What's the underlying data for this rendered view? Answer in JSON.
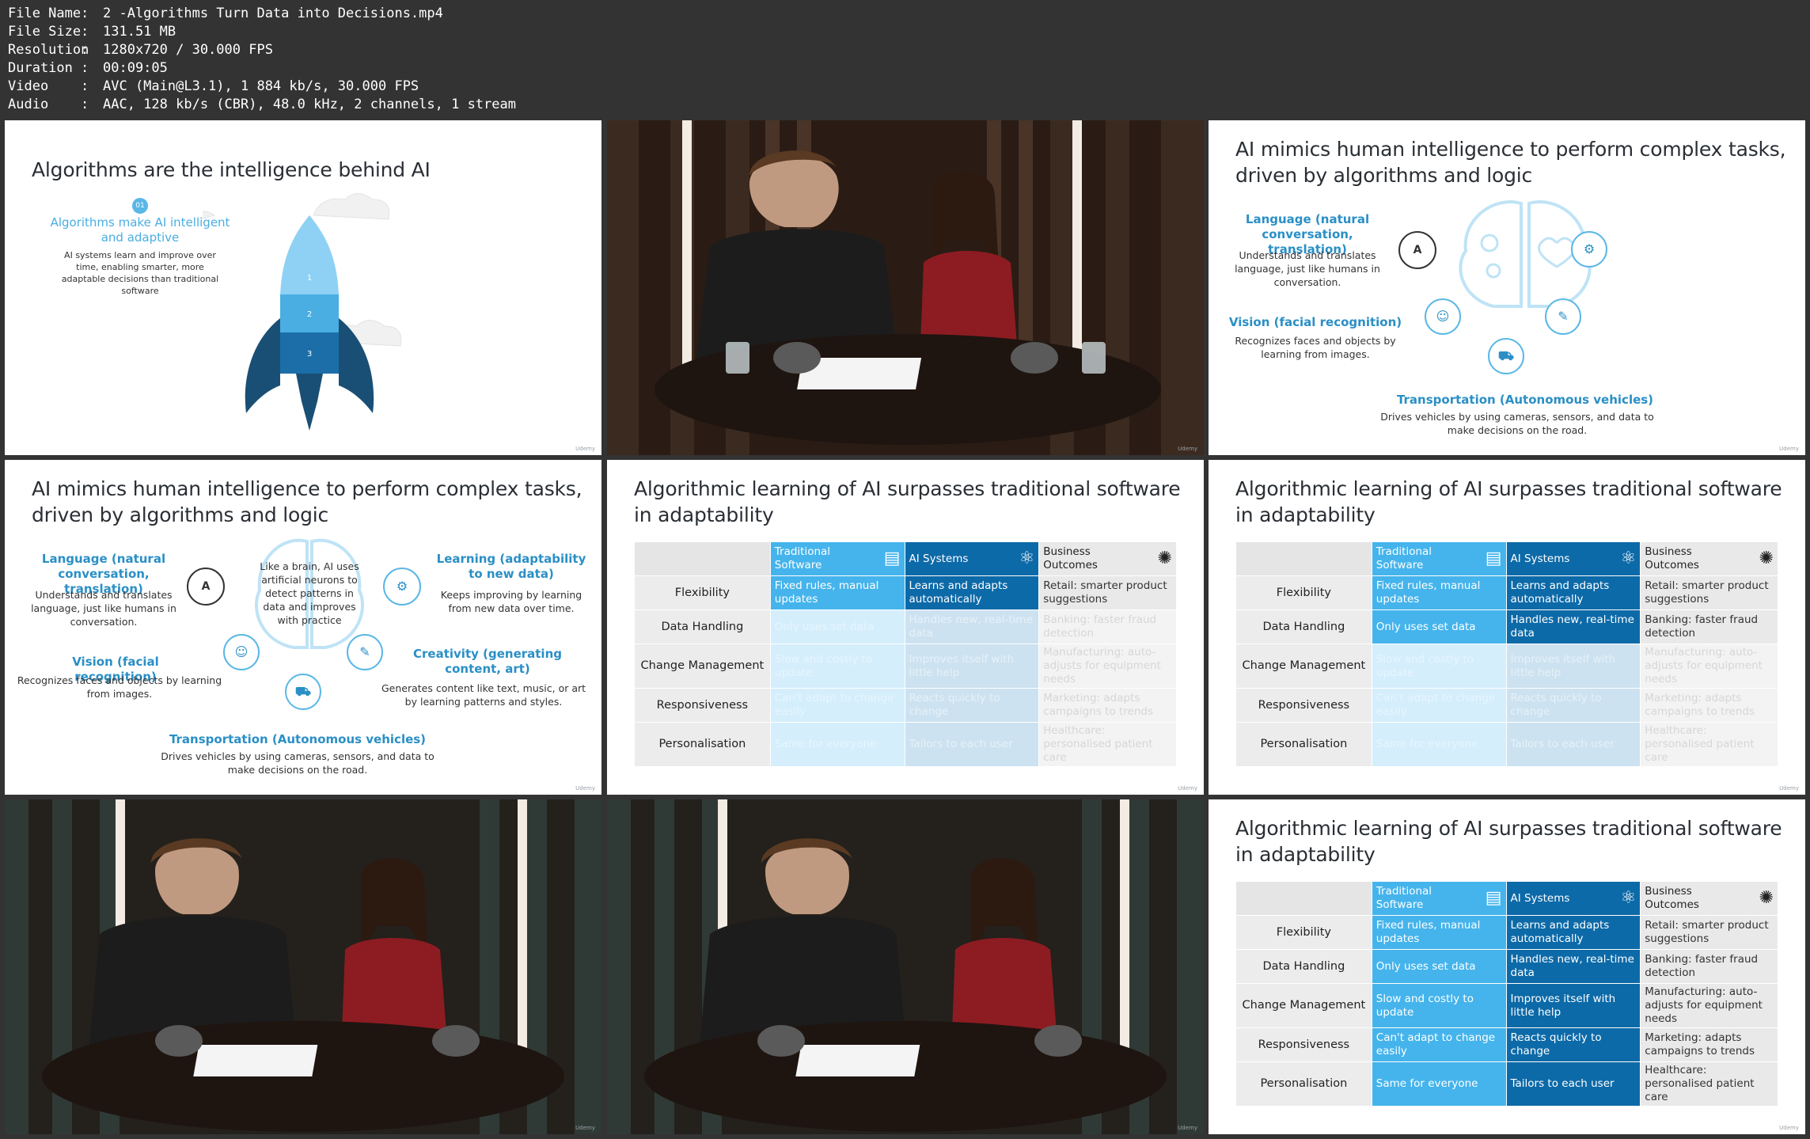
{
  "file_info": [
    {
      "key": "File Name",
      "value": "2 -Algorithms Turn Data into Decisions.mp4"
    },
    {
      "key": "File Size",
      "value": "131.51 MB"
    },
    {
      "key": "Resolution",
      "value": "1280x720 / 30.000 FPS"
    },
    {
      "key": "Duration",
      "value": "00:09:05"
    },
    {
      "key": "Video",
      "value": "AVC (Main@L3.1), 1 884 kb/s, 30.000 FPS"
    },
    {
      "key": "Audio",
      "value": "AAC, 128 kb/s (CBR), 48.0 kHz, 2 channels, 1 stream"
    }
  ],
  "separator": ":",
  "watermark": "Udemy",
  "slide_rocket": {
    "title": "Algorithms are the intelligence behind AI",
    "badge": "01",
    "heading": "Algorithms make AI intelligent and adaptive",
    "body": "AI systems learn and improve over time, enabling smarter, more adaptable decisions than traditional software",
    "stages": [
      "1",
      "2",
      "3"
    ]
  },
  "slide_mimics_a": {
    "title": "AI mimics human intelligence to perform complex tasks, driven by algorithms and logic",
    "language_title": "Language (natural conversation, translation)",
    "language_body": "Understands and translates language, just like humans in conversation.",
    "vision_title": "Vision (facial recognition)",
    "vision_body": "Recognizes faces and objects by learning from images.",
    "transport_title": "Transportation (Autonomous vehicles)",
    "transport_body": "Drives vehicles by using cameras, sensors, and data to make decisions on the road."
  },
  "slide_mimics_b": {
    "title": "AI mimics human intelligence to perform complex tasks, driven by algorithms and logic",
    "language_title": "Language (natural conversation, translation)",
    "language_body": "Understands and translates language, just like humans in conversation.",
    "brain_text": "Like a brain, AI uses artificial neurons to detect patterns in data and improves with practice",
    "learning_title": "Learning (adaptability to new data)",
    "learning_body": "Keeps improving by learning from new data over time.",
    "vision_title": "Vision (facial recognition)",
    "vision_body": "Recognizes faces and objects by learning from images.",
    "creativity_title": "Creativity (generating content, art)",
    "creativity_body": "Generates content like text, music, or art by learning patterns and styles.",
    "transport_title": "Transportation (Autonomous vehicles)",
    "transport_body": "Drives vehicles by using cameras, sensors, and data to make decisions on the road."
  },
  "table": {
    "title": "Algorithmic learning of AI surpasses traditional software in adaptability",
    "headers": [
      "Traditional Software",
      "AI Systems",
      "Business Outcomes"
    ],
    "rows": [
      {
        "label": "Flexibility",
        "trad": "Fixed rules, manual updates",
        "ai": "Learns and adapts automatically",
        "biz": "Retail: smarter product suggestions"
      },
      {
        "label": "Data Handling",
        "trad": "Only uses set data",
        "ai": "Handles new, real-time data",
        "biz": "Banking: faster fraud detection"
      },
      {
        "label": "Change Management",
        "trad": "Slow and costly to update",
        "ai": "Improves itself with little help",
        "biz": "Manufacturing: auto-adjusts for equipment needs"
      },
      {
        "label": "Responsiveness",
        "trad": "Can't adapt to change easily",
        "ai": "Reacts quickly to change",
        "biz": "Marketing: adapts campaigns to trends"
      },
      {
        "label": "Personalisation",
        "trad": "Same for everyone",
        "ai": "Tailors to each user",
        "biz": "Healthcare: personalised patient care"
      }
    ]
  },
  "table_states": [
    {
      "highlighted_rows": 1
    },
    {
      "highlighted_rows": 2
    },
    {
      "highlighted_rows": 5
    }
  ],
  "colors": {
    "traditional": "#45b4ec",
    "ai": "#0d6aa8",
    "accent": "#2a8fc6",
    "background": "#333333"
  }
}
